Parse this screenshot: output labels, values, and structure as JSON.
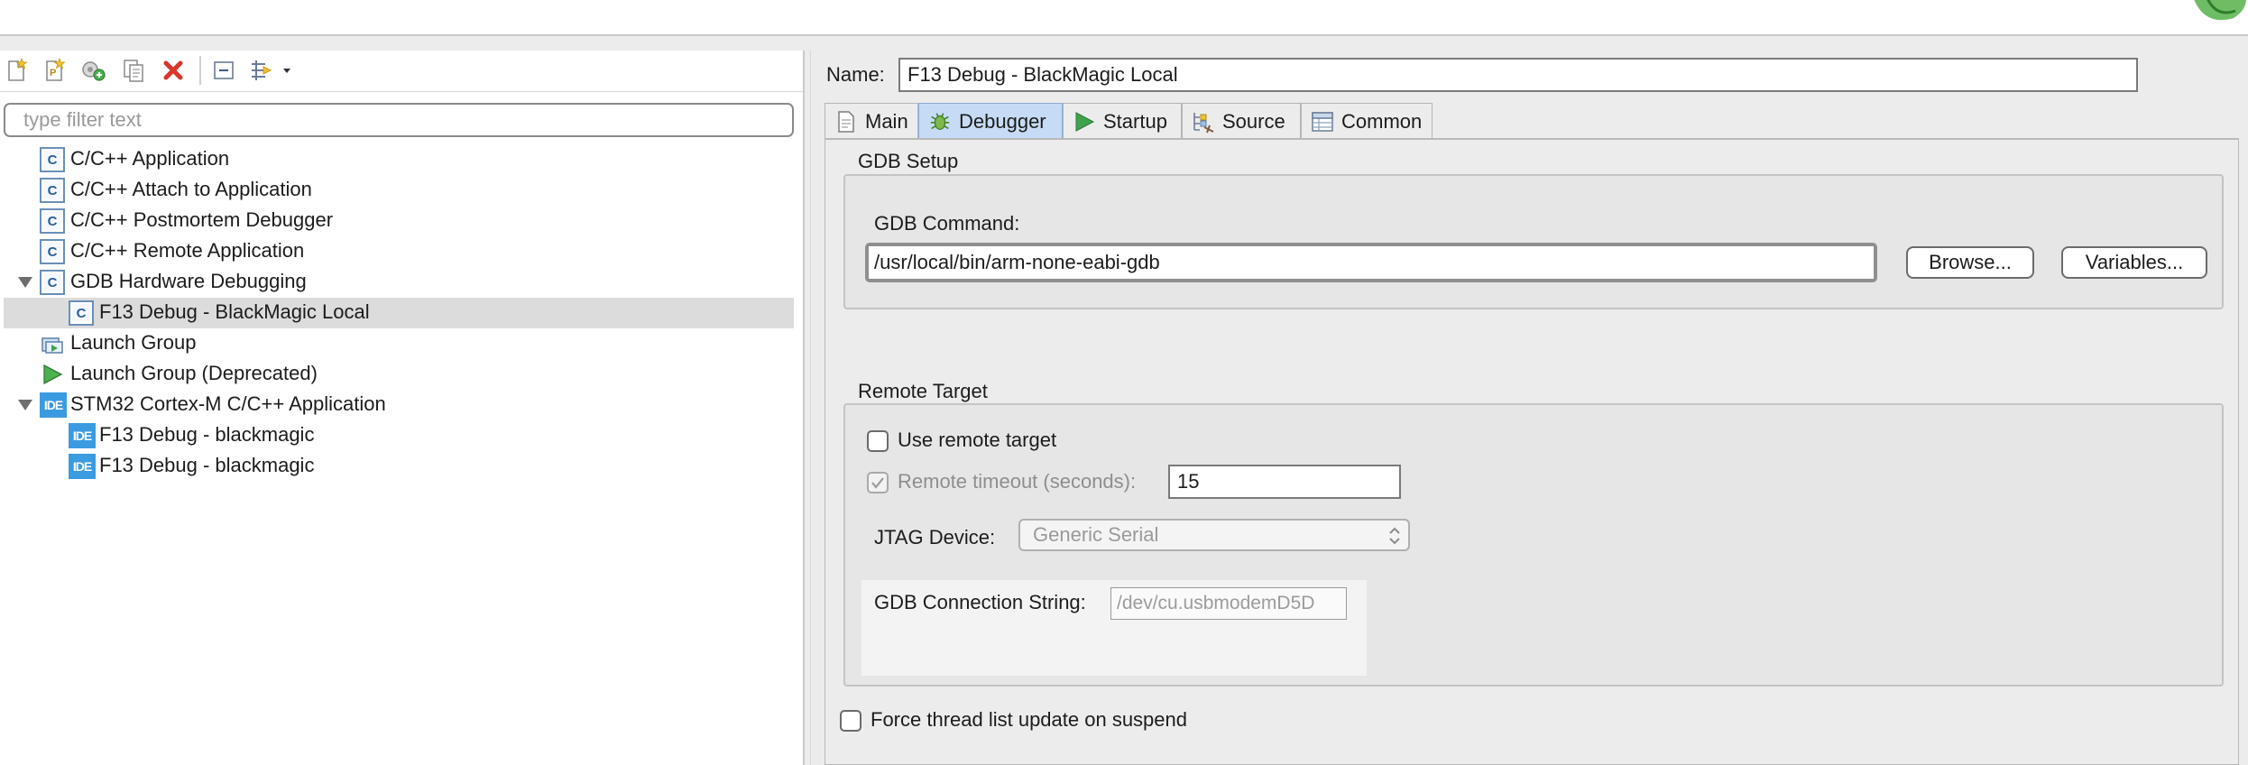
{
  "toolbar": {
    "buttons": [
      {
        "icon": "new-launch-config-icon"
      },
      {
        "icon": "new-prototype-icon"
      },
      {
        "icon": "export-icon"
      },
      {
        "icon": "duplicate-icon"
      },
      {
        "icon": "delete-icon"
      },
      {
        "icon": "collapse-all-icon"
      },
      {
        "icon": "filter-icon"
      }
    ]
  },
  "filter": {
    "placeholder": "type filter text",
    "value": ""
  },
  "tree": {
    "items": [
      {
        "label": "C/C++ Application",
        "icon": "c-icon"
      },
      {
        "label": "C/C++ Attach to Application",
        "icon": "c-icon"
      },
      {
        "label": "C/C++ Postmortem Debugger",
        "icon": "c-icon"
      },
      {
        "label": "C/C++ Remote Application",
        "icon": "c-icon"
      },
      {
        "label": "GDB Hardware Debugging",
        "icon": "c-icon",
        "expanded": true
      },
      {
        "label": "F13 Debug - BlackMagic Local",
        "icon": "c-icon",
        "selected": true
      },
      {
        "label": "Launch Group",
        "icon": "launch-group-icon"
      },
      {
        "label": "Launch Group (Deprecated)",
        "icon": "launch-arrow-icon"
      },
      {
        "label": "STM32 Cortex-M C/C++ Application",
        "icon": "ide-icon",
        "expanded": true
      },
      {
        "label": "F13 Debug - blackmagic",
        "icon": "ide-icon"
      },
      {
        "label": "F13 Debug - blackmagic",
        "icon": "ide-icon"
      }
    ],
    "ide_icon_text": "IDE",
    "c_icon_text": "C"
  },
  "config": {
    "name_label": "Name:",
    "name_value": "F13 Debug - BlackMagic Local"
  },
  "tabs": [
    {
      "label": "Main",
      "icon": "main-page-icon"
    },
    {
      "label": "Debugger",
      "icon": "debugger-bug-icon",
      "active": true
    },
    {
      "label": "Startup",
      "icon": "startup-play-icon"
    },
    {
      "label": "Source",
      "icon": "source-icon"
    },
    {
      "label": "Common",
      "icon": "common-table-icon"
    }
  ],
  "gdb_setup": {
    "title": "GDB Setup",
    "command_label": "GDB Command:",
    "command_value": "/usr/local/bin/arm-none-eabi-gdb",
    "browse_label": "Browse...",
    "variables_label": "Variables..."
  },
  "remote_target": {
    "title": "Remote Target",
    "use_remote_label": "Use remote target",
    "use_remote_checked": false,
    "timeout_label": "Remote timeout (seconds):",
    "timeout_checked": true,
    "timeout_value": "15",
    "jtag_label": "JTAG Device:",
    "jtag_value": "Generic Serial",
    "conn_label": "GDB Connection String:",
    "conn_value": "/dev/cu.usbmodemD5D"
  },
  "force_thread": {
    "label": "Force thread list update on suspend",
    "checked": false
  },
  "colors": {
    "active_tab": "#c6dbf5",
    "selection": "#dcdcdc",
    "ide_blue": "#3b9be0",
    "delete_red": "#d9362c"
  }
}
